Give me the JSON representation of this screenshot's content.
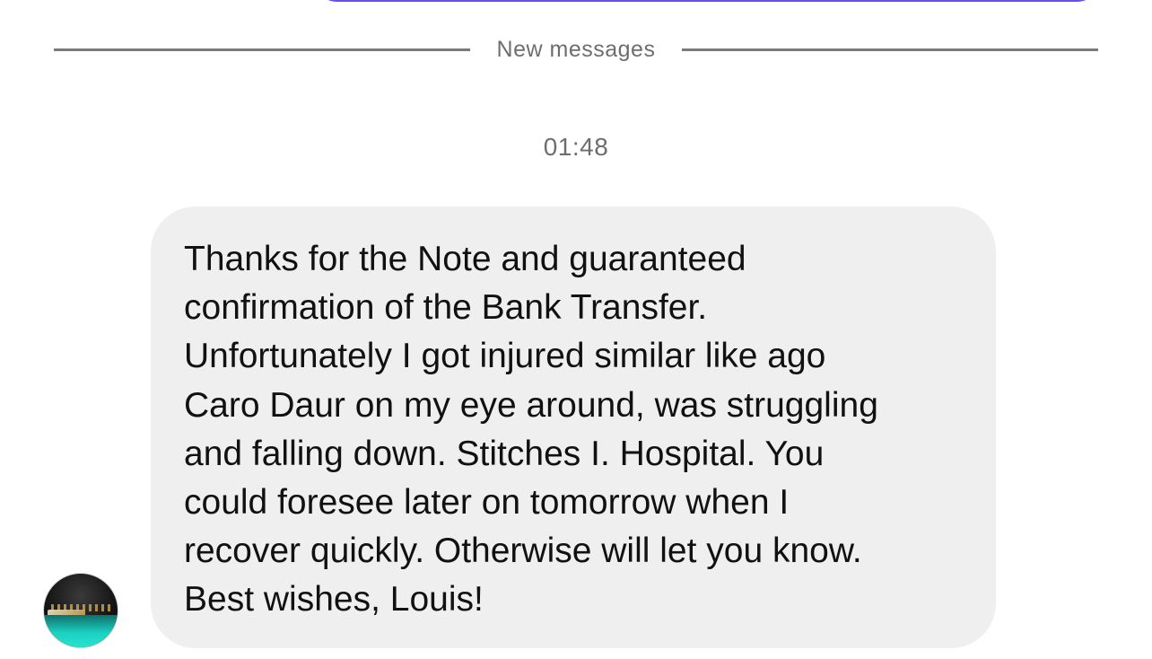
{
  "thread": {
    "divider_label": "New messages",
    "timestamp": "01:48"
  },
  "message": {
    "text": "Thanks for the Note and guaranteed\nconfirmation of the Bank Transfer.\nUnfortunately I got injured similar like ago\nCaro Daur on my eye around, was struggling\nand falling down. Stitches I. Hospital. You\ncould foresee later on tomorrow when I\nrecover quickly. Otherwise will let you know.\nBest wishes, Louis!"
  },
  "colors": {
    "previous_bubble_border": "#6a4cf5",
    "received_bubble_bg": "#efefef",
    "meta_text": "#6e6e6e"
  },
  "icons": {
    "sender_avatar": "avatar-photo-night-harbor"
  }
}
